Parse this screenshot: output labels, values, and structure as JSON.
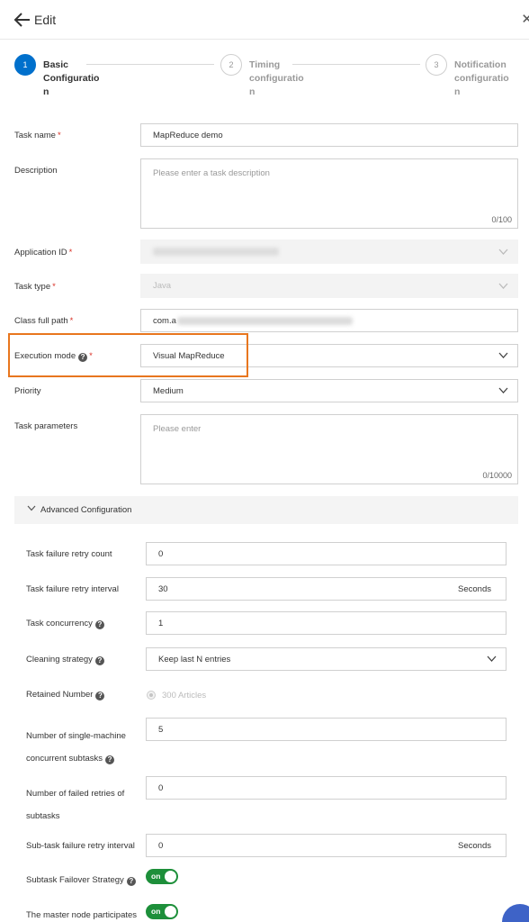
{
  "header": {
    "title": "Edit"
  },
  "steps": [
    {
      "number": "1",
      "label_lines": [
        "Basic",
        "Configuratio",
        "n"
      ]
    },
    {
      "number": "2",
      "label_lines": [
        "Timing",
        "configuratio",
        "n"
      ]
    },
    {
      "number": "3",
      "label_lines": [
        "Notification",
        "configuratio",
        "n"
      ]
    }
  ],
  "form": {
    "required_mark": "*",
    "task_name": {
      "label": "Task name",
      "value": "MapReduce demo"
    },
    "description": {
      "label": "Description",
      "placeholder": "Please enter a task description",
      "counter": "0/100"
    },
    "application_id": {
      "label": "Application ID"
    },
    "task_type": {
      "label": "Task type",
      "value": "Java"
    },
    "class_full_path": {
      "label": "Class full path",
      "value_prefix": "com.a"
    },
    "execution_mode": {
      "label": "Execution mode",
      "value": "Visual MapReduce"
    },
    "priority": {
      "label": "Priority",
      "value": "Medium"
    },
    "task_parameters": {
      "label": "Task parameters",
      "placeholder": "Please enter",
      "counter": "0/10000"
    }
  },
  "advanced": {
    "title": "Advanced Configuration",
    "retry_count": {
      "label": "Task failure retry count",
      "value": "0"
    },
    "retry_interval": {
      "label": "Task failure retry interval",
      "value": "30",
      "suffix": "Seconds"
    },
    "concurrency": {
      "label": "Task concurrency",
      "value": "1"
    },
    "cleaning": {
      "label": "Cleaning strategy",
      "value": "Keep last N entries"
    },
    "retained": {
      "label": "Retained Number",
      "value": "300 Articles"
    },
    "single_machine": {
      "label_lines": [
        "Number of single-machine",
        "concurrent subtasks"
      ],
      "value": "5"
    },
    "failed_retries": {
      "label_lines": [
        "Number of failed retries of",
        "subtasks"
      ],
      "value": "0"
    },
    "subtask_interval": {
      "label": "Sub-task failure retry interval",
      "value": "0",
      "suffix": "Seconds"
    },
    "failover": {
      "label": "Subtask Failover Strategy",
      "switch_text": "on"
    },
    "master_node": {
      "label": "The master node participates",
      "switch_text": "on"
    }
  }
}
